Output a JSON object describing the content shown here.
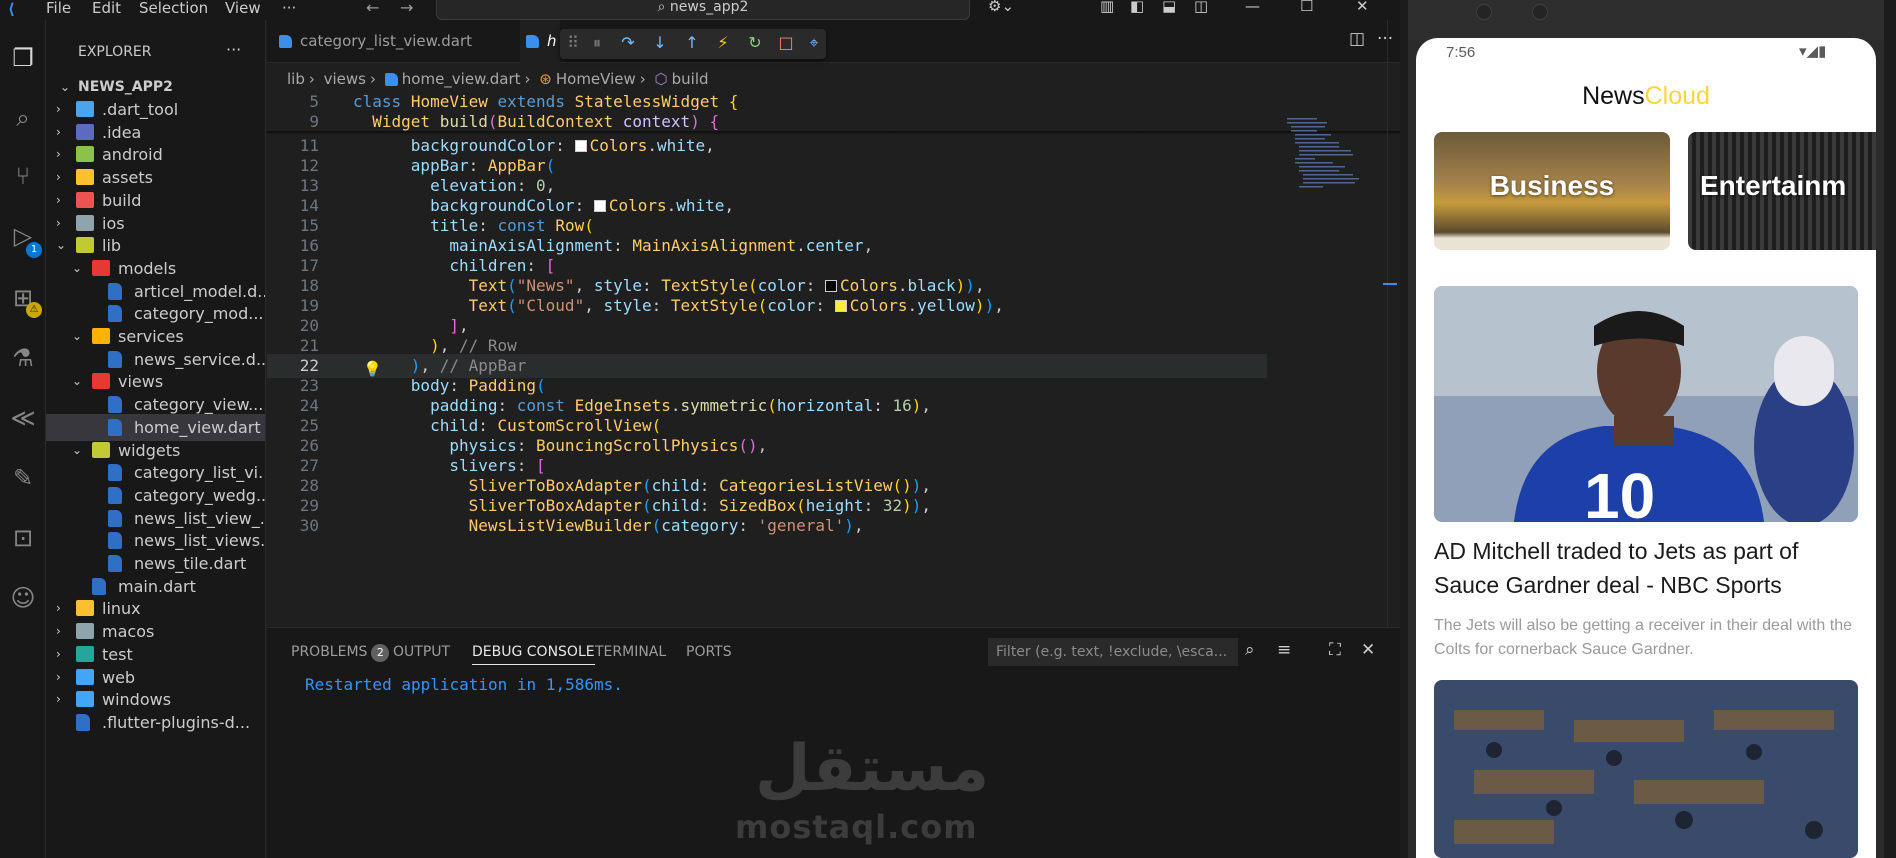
{
  "titlebar": {
    "menus": [
      "File",
      "Edit",
      "Selection",
      "View",
      "···"
    ],
    "search": "news_app2"
  },
  "activity_bar": {
    "debug_badge": "1",
    "extensions_badge": "⚠"
  },
  "sidebar": {
    "title": "EXPLORER",
    "more": "···",
    "project": "NEWS_APP2",
    "items": [
      {
        "label": ".dart_tool",
        "type": "folder",
        "color": "#4aa5f0"
      },
      {
        "label": ".idea",
        "type": "folder",
        "color": "#5c6bc0"
      },
      {
        "label": "android",
        "type": "folder",
        "color": "#8bc34a"
      },
      {
        "label": "assets",
        "type": "folder",
        "color": "#fbc02d"
      },
      {
        "label": "build",
        "type": "folder",
        "color": "#ef5350"
      },
      {
        "label": "ios",
        "type": "folder",
        "color": "#90a4ae"
      },
      {
        "label": "lib",
        "type": "folder",
        "color": "#c0ca33"
      },
      {
        "label": "models",
        "type": "folder",
        "color": "#e53935"
      },
      {
        "label": "articel_model.d...",
        "type": "file"
      },
      {
        "label": "category_mod...",
        "type": "file"
      },
      {
        "label": "services",
        "type": "folder",
        "color": "#ffb300"
      },
      {
        "label": "news_service.d...",
        "type": "file"
      },
      {
        "label": "views",
        "type": "folder",
        "color": "#e53935"
      },
      {
        "label": "category_view....",
        "type": "file"
      },
      {
        "label": "home_view.dart",
        "type": "file"
      },
      {
        "label": "widgets",
        "type": "folder",
        "color": "#c0ca33"
      },
      {
        "label": "category_list_vi...",
        "type": "file"
      },
      {
        "label": "category_wedg...",
        "type": "file"
      },
      {
        "label": "news_list_view_...",
        "type": "file"
      },
      {
        "label": "news_list_views...",
        "type": "file"
      },
      {
        "label": "news_tile.dart",
        "type": "file"
      },
      {
        "label": "main.dart",
        "type": "file"
      },
      {
        "label": "linux",
        "type": "folder",
        "color": "#fbc02d"
      },
      {
        "label": "macos",
        "type": "folder",
        "color": "#90a4ae"
      },
      {
        "label": "test",
        "type": "folder",
        "color": "#26a69a"
      },
      {
        "label": "web",
        "type": "folder",
        "color": "#42a5f5"
      },
      {
        "label": "windows",
        "type": "folder",
        "color": "#42a5f5"
      },
      {
        "label": ".flutter-plugins-d...",
        "type": "file"
      }
    ]
  },
  "editor": {
    "tabs": [
      "category_list_view.dart",
      "h"
    ],
    "breadcrumb": [
      "lib",
      "views",
      "home_view.dart",
      "HomeView",
      "build"
    ],
    "line_numbers": [
      "5",
      "9",
      "11",
      "12",
      "13",
      "14",
      "15",
      "16",
      "17",
      "18",
      "19",
      "20",
      "21",
      "22",
      "23",
      "24",
      "25",
      "26",
      "27",
      "28",
      "29",
      "30"
    ],
    "comments": [
      "// Row",
      "// AppBar"
    ]
  },
  "panel": {
    "tabs": [
      "PROBLEMS",
      "OUTPUT",
      "DEBUG CONSOLE",
      "TERMINAL",
      "PORTS"
    ],
    "problems_count": "2",
    "filter_placeholder": "Filter (e.g. text, !exclude, \\esca...",
    "console_output": "Restarted application in 1,586ms."
  },
  "watermark": {
    "arabic": "مستقل",
    "latin": "mostaql.com"
  },
  "phone": {
    "time": "7:56",
    "app_title_part1": "News",
    "app_title_part2": "Cloud",
    "categories": [
      "Business",
      "Entertainm"
    ],
    "article": {
      "title": "AD Mitchell traded to Jets as part of Sauce Gardner deal - NBC Sports",
      "subtitle": "The Jets will also be getting a receiver in their deal with the Colts for cornerback Sauce Gardner."
    }
  }
}
